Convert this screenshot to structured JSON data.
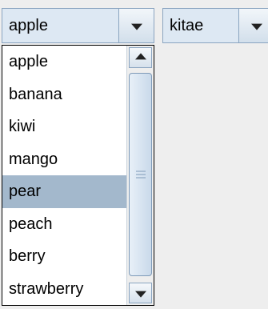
{
  "combo1": {
    "selected_value": "apple",
    "options": [
      "apple",
      "banana",
      "kiwi",
      "mango",
      "pear",
      "peach",
      "berry",
      "strawberry"
    ],
    "highlighted_index": 4
  },
  "combo2": {
    "selected_value": "kitae"
  },
  "icons": {
    "dropdown_arrow": "chevron-down-icon",
    "scroll_up": "arrow-up-icon",
    "scroll_down": "arrow-down-icon"
  },
  "colors": {
    "combo_bg": "#dde8f3",
    "highlight": "#a3b8cc",
    "border": "#8aa4c0"
  }
}
